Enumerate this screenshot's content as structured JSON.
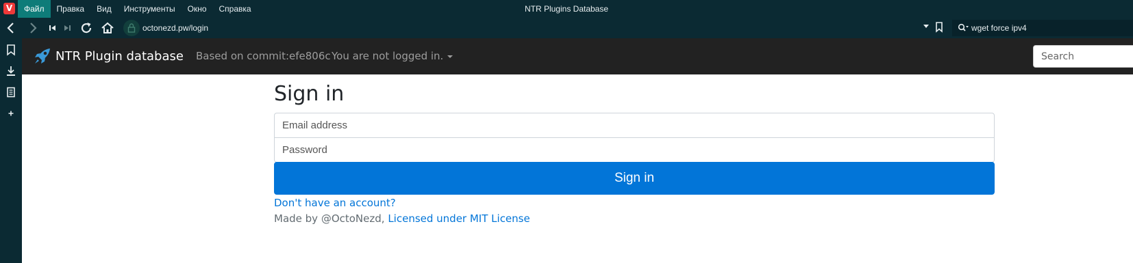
{
  "browser": {
    "logo_letter": "V",
    "menu": [
      "Файл",
      "Правка",
      "Вид",
      "Инструменты",
      "Окно",
      "Справка"
    ],
    "window_title": "NTR Plugins Database",
    "url": "octonezd.pw/login",
    "search_query": "wget force ipv4"
  },
  "site": {
    "brand": "NTR Plugin database",
    "commit_text": "Based on commit:efe806c",
    "login_state": "You are not logged in.",
    "search_placeholder": "Search"
  },
  "form": {
    "heading": "Sign in",
    "email_placeholder": "Email address",
    "password_placeholder": "Password",
    "submit_label": "Sign in",
    "signup_link": "Don't have an account?"
  },
  "footer": {
    "made_by": "Made by @OctoNezd,",
    "license_link": "Licensed under MIT License"
  },
  "colors": {
    "chrome_bg": "#0b2a33",
    "active_menu": "#0e7c79",
    "site_nav_bg": "#222222",
    "primary": "#0275d8",
    "brand_icon": "#3a9ad9"
  }
}
